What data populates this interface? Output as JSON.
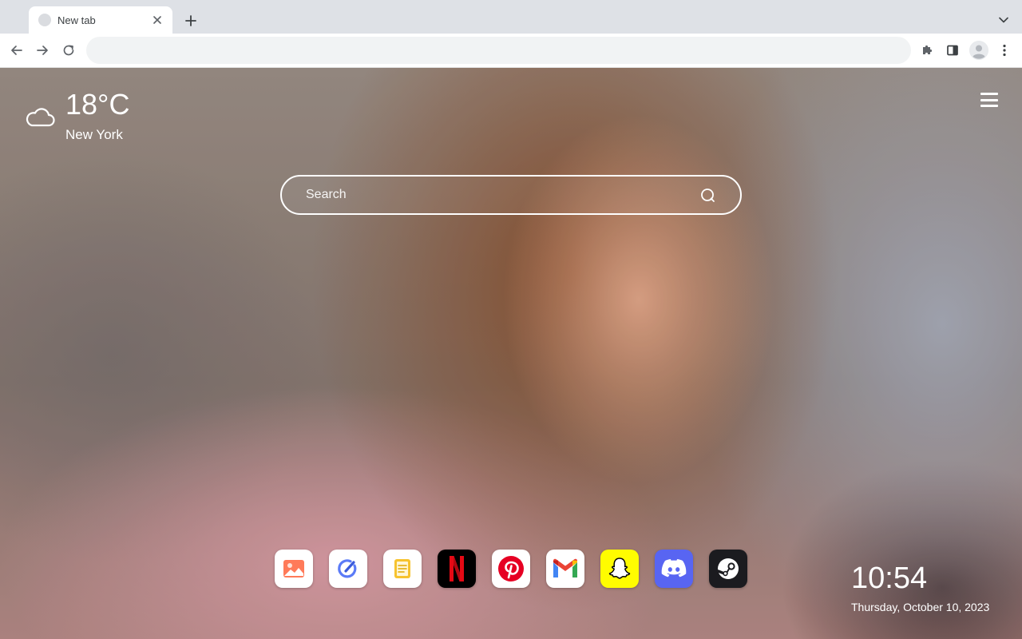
{
  "browser": {
    "tab": {
      "title": "New tab"
    },
    "omnibox": {
      "value": "",
      "placeholder": ""
    }
  },
  "weather": {
    "temperature": "18°C",
    "city": "New York",
    "icon": "cloud-icon"
  },
  "search": {
    "placeholder": "Search"
  },
  "shortcuts": [
    {
      "name": "photos",
      "icon": "image-icon",
      "bg": "#ffffff"
    },
    {
      "name": "quick-edit",
      "icon": "pen-circle-icon",
      "bg": "#ffffff"
    },
    {
      "name": "notes",
      "icon": "note-icon",
      "bg": "#ffffff"
    },
    {
      "name": "netflix",
      "icon": "netflix-icon",
      "bg": "#000000",
      "accent": "#e50914"
    },
    {
      "name": "pinterest",
      "icon": "pinterest-icon",
      "bg": "#ffffff",
      "accent": "#e60023"
    },
    {
      "name": "gmail",
      "icon": "gmail-icon",
      "bg": "#ffffff",
      "accent": "#ea4335"
    },
    {
      "name": "snapchat",
      "icon": "snapchat-icon",
      "bg": "#fffc00"
    },
    {
      "name": "discord",
      "icon": "discord-icon",
      "bg": "#5865f2"
    },
    {
      "name": "steam",
      "icon": "steam-icon",
      "bg": "#1b1b1f"
    }
  ],
  "clock": {
    "time": "10:54",
    "date": "Thursday, October 10, 2023"
  }
}
